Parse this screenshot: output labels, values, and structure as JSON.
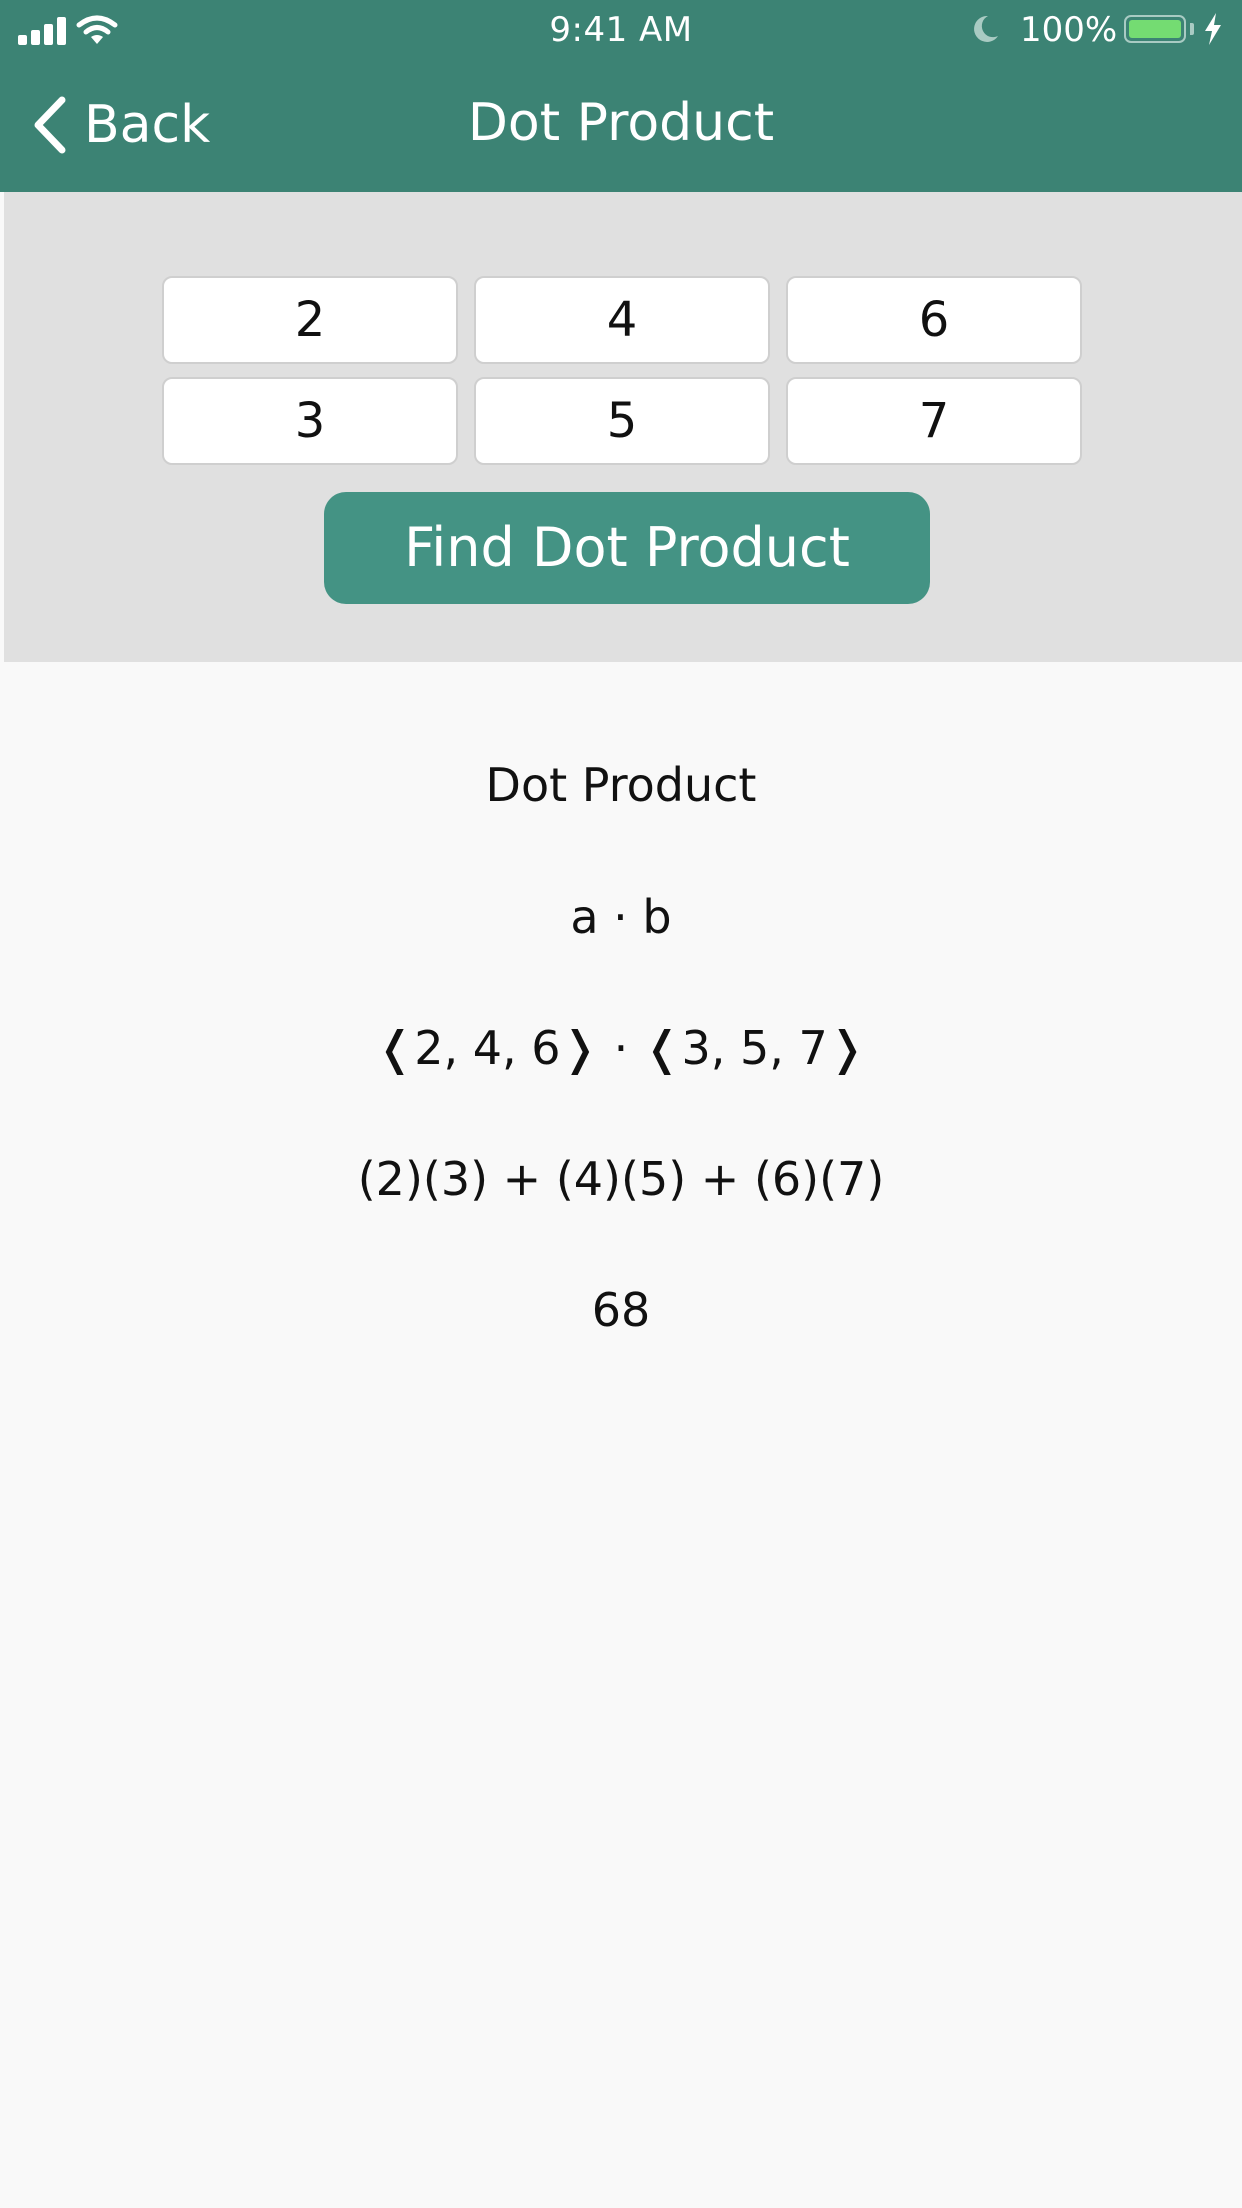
{
  "status_bar": {
    "time": "9:41 AM",
    "battery_percent": "100%",
    "icons": [
      "signal-icon",
      "wifi-icon",
      "moon-icon",
      "battery-icon",
      "charging-bolt-icon"
    ]
  },
  "nav": {
    "back_label": "Back",
    "title": "Dot Product",
    "color": "#3c8374"
  },
  "inputs": {
    "vector_a": [
      "2",
      "4",
      "6"
    ],
    "vector_b": [
      "3",
      "5",
      "7"
    ]
  },
  "find_button": {
    "label": "Find Dot Product",
    "color": "#449384"
  },
  "results": {
    "heading": "Dot Product",
    "formula": "a · b",
    "vectors": "❬2, 4, 6❭ · ❬3, 5, 7❭",
    "expansion": "(2)(3) + (4)(5) + (6)(7)",
    "answer": "68"
  }
}
